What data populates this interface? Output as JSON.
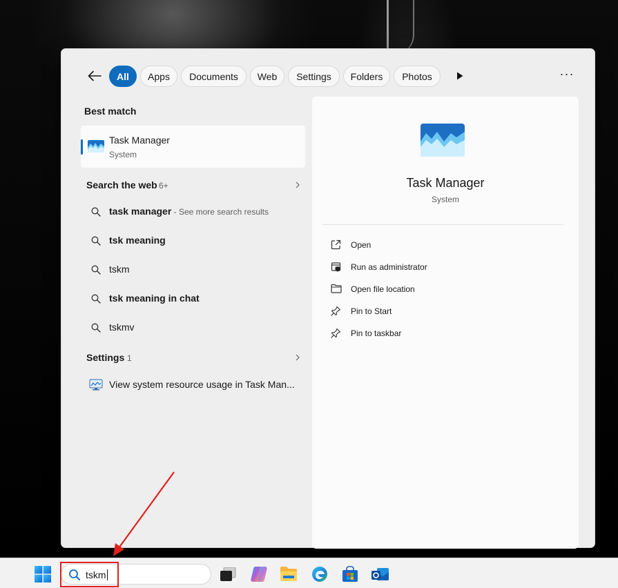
{
  "filters": {
    "tabs": [
      {
        "label": "All",
        "active": true
      },
      {
        "label": "Apps"
      },
      {
        "label": "Documents"
      },
      {
        "label": "Web"
      },
      {
        "label": "Settings"
      },
      {
        "label": "Folders"
      },
      {
        "label": "Photos"
      }
    ]
  },
  "best_match": {
    "heading": "Best match",
    "name": "Task Manager",
    "subtitle": "System"
  },
  "web": {
    "heading": "Search the web",
    "count": "6+",
    "items": [
      {
        "text": "task manager",
        "suffix": " - See more search results"
      },
      {
        "text": "tsk meaning"
      },
      {
        "text": "tskm"
      },
      {
        "text": "tsk meaning in chat"
      },
      {
        "text": "tskmv"
      }
    ]
  },
  "settings": {
    "heading": "Settings",
    "count": "1",
    "item": "View system resource usage in Task Man..."
  },
  "detail": {
    "title": "Task Manager",
    "subtitle": "System",
    "actions": [
      {
        "label": "Open",
        "icon": "open-icon"
      },
      {
        "label": "Run as administrator",
        "icon": "shield-icon"
      },
      {
        "label": "Open file location",
        "icon": "folder-icon"
      },
      {
        "label": "Pin to Start",
        "icon": "pin-icon"
      },
      {
        "label": "Pin to taskbar",
        "icon": "pin-icon"
      }
    ]
  },
  "taskbar": {
    "search_value": "tskm"
  },
  "colors": {
    "accent": "#0f6cbd",
    "annotation": "#e0201c"
  }
}
